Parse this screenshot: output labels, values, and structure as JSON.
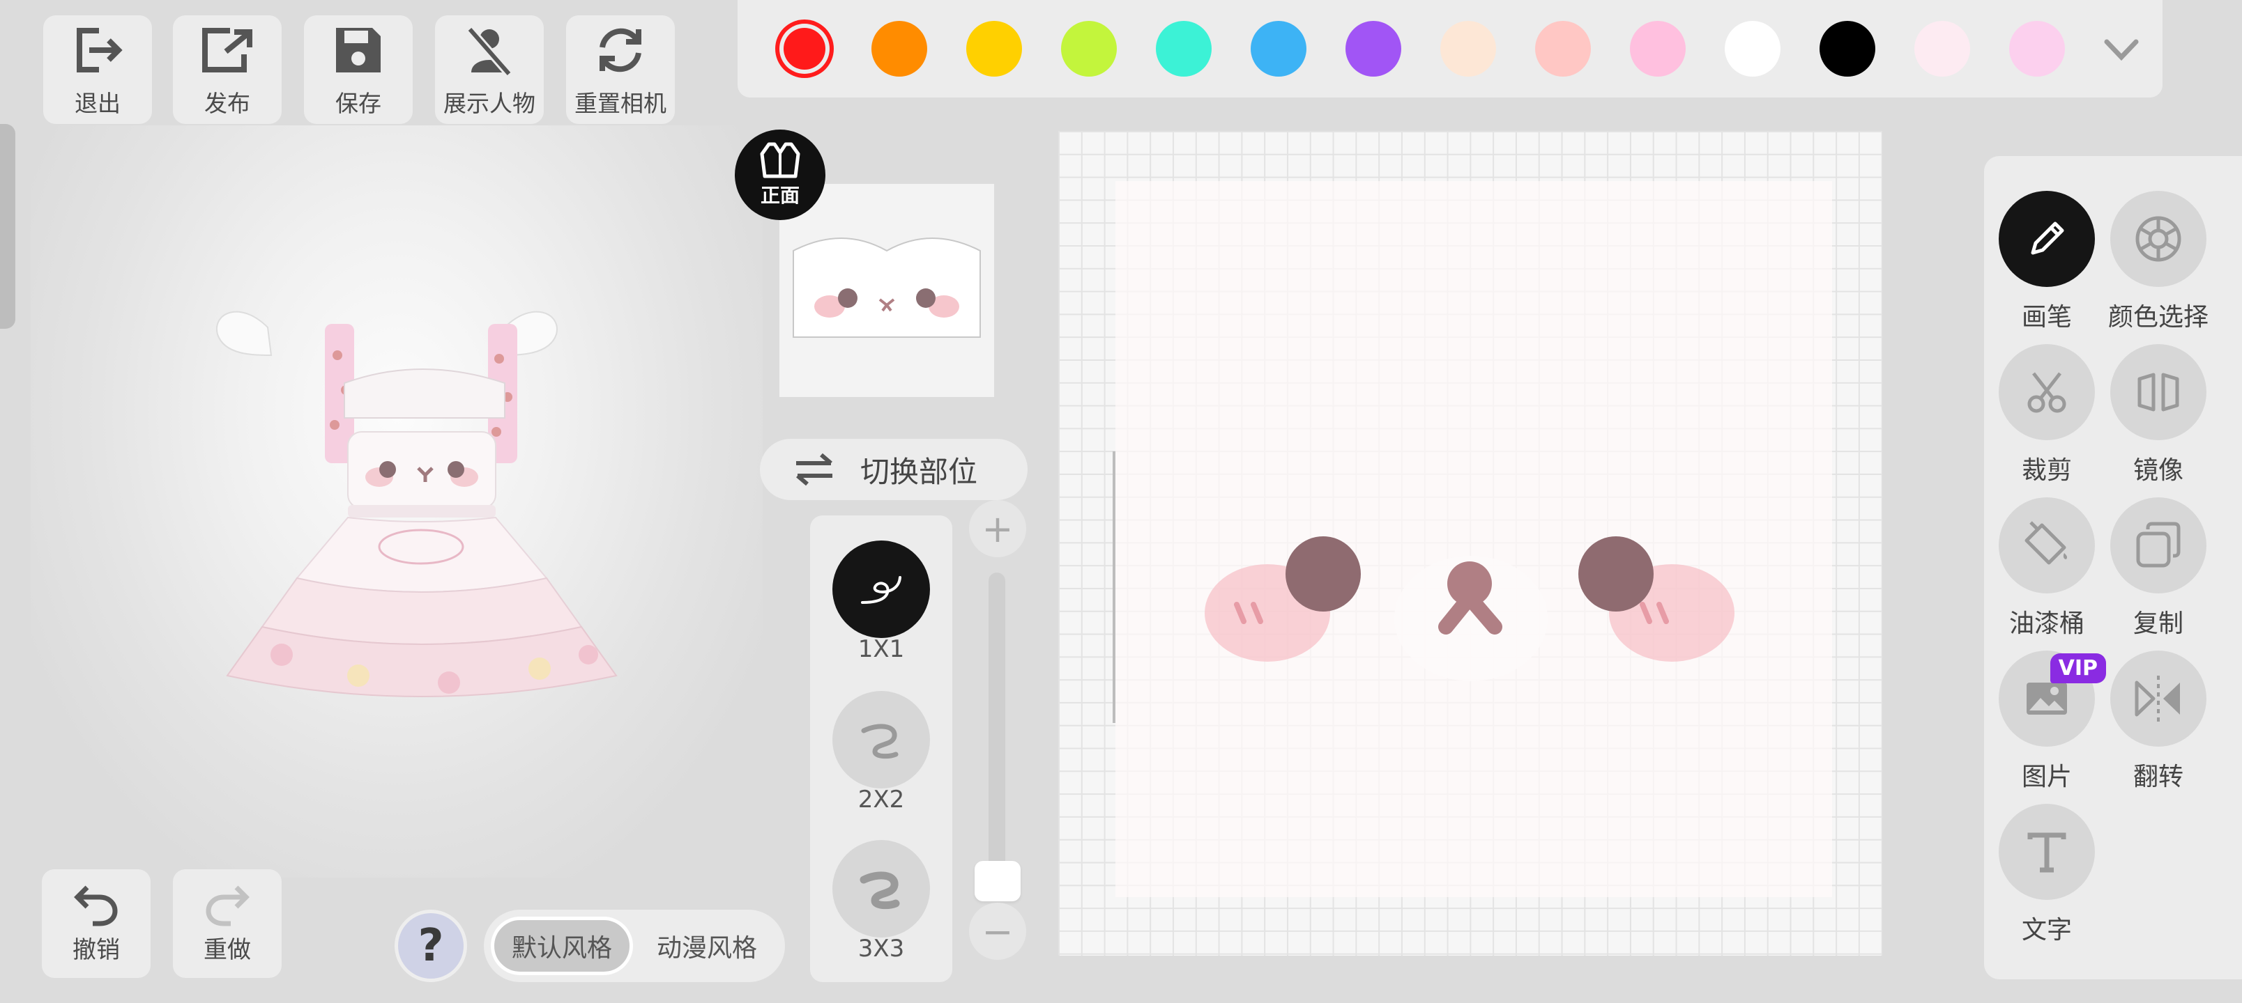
{
  "toolbar": {
    "exit": "退出",
    "publish": "发布",
    "save": "保存",
    "show_character": "展示人物",
    "reset_camera": "重置相机"
  },
  "palette": {
    "colors": [
      "#ff1a1a",
      "#ff8c00",
      "#ffd000",
      "#c3f53c",
      "#3cf2d6",
      "#3db3f5",
      "#a155f5",
      "#fde7d6",
      "#ffc7c4",
      "#ffc0df",
      "#ffffff",
      "#000000",
      "#fdebf2",
      "#fcd0ee"
    ],
    "selected_index": 0
  },
  "part": {
    "badge_label": "正面",
    "switch_label": "切换部位"
  },
  "brush_sizes": [
    "1X1",
    "2X2",
    "3X3"
  ],
  "brush_selected": 0,
  "slider": {
    "plus": "+",
    "minus": "−",
    "level": 0.1
  },
  "tools": {
    "brush": "画笔",
    "color_pick": "颜色选择",
    "crop": "裁剪",
    "mirror": "镜像",
    "bucket": "油漆桶",
    "copy": "复制",
    "image": "图片",
    "image_badge": "VIP",
    "flip": "翻转",
    "text": "文字"
  },
  "history": {
    "undo": "撤销",
    "redo": "重做"
  },
  "style": {
    "help": "?",
    "default": "默认风格",
    "anime": "动漫风格"
  },
  "colors": {
    "accent_dark": "#151515",
    "panel_bg": "#ececec",
    "page_bg": "#dcdcdc",
    "vip": "#8a2be2"
  }
}
